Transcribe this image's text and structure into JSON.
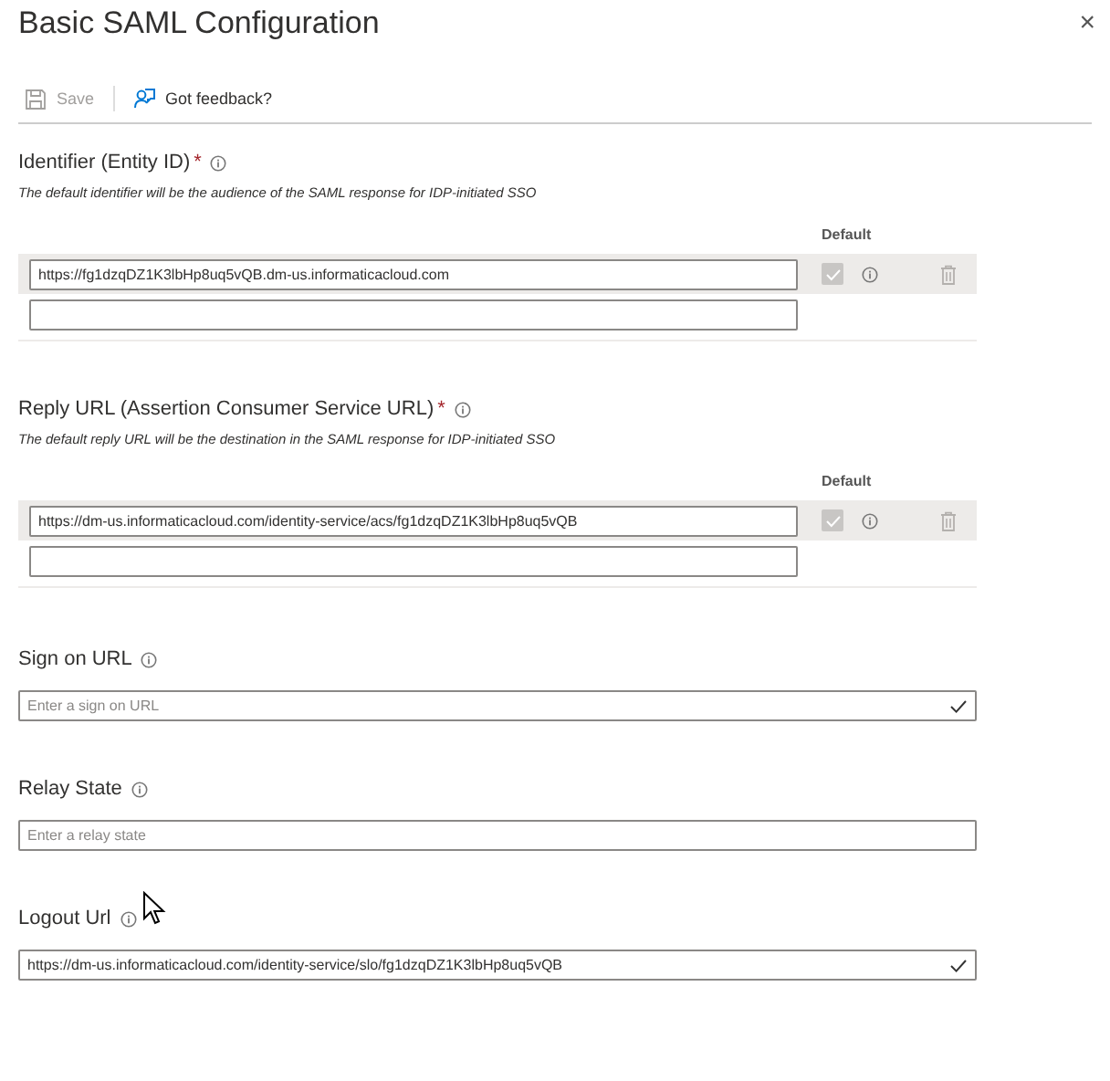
{
  "panel": {
    "title": "Basic SAML Configuration",
    "close": "×"
  },
  "toolbar": [
    {
      "label": "Save",
      "kind": "save",
      "disabled": true
    },
    {
      "label": "Got feedback?",
      "kind": "feedback",
      "disabled": false
    }
  ],
  "url_sections": [
    {
      "label": "Identifier (Entity ID)",
      "required_mark": "*",
      "description": "The default identifier will be the audience of the SAML response for IDP-initiated SSO",
      "default_header": "Default",
      "rows": [
        {
          "value": "https://fg1dzqDZ1K3lbHp8uq5vQB.dm-us.informaticacloud.com",
          "checked": true,
          "disabled": true
        }
      ]
    },
    {
      "label": "Reply URL (Assertion Consumer Service URL)",
      "required_mark": "*",
      "description": "The default reply URL will be the destination in the SAML response for IDP-initiated SSO",
      "default_header": "Default",
      "rows": [
        {
          "value": "https://dm-us.informaticacloud.com/identity-service/acs/fg1dzqDZ1K3lbHp8uq5vQB",
          "checked": true,
          "disabled": true
        }
      ]
    }
  ],
  "fields": [
    {
      "label": "Sign on URL",
      "placeholder": "Enter a sign on URL",
      "validated": true
    },
    {
      "label": "Relay State",
      "placeholder": "Enter a relay state",
      "validated": false
    },
    {
      "label": "Logout Url",
      "value": "https://dm-us.informaticacloud.com/identity-service/slo/fg1dzqDZ1K3lbHp8uq5vQB",
      "validated": true
    }
  ]
}
